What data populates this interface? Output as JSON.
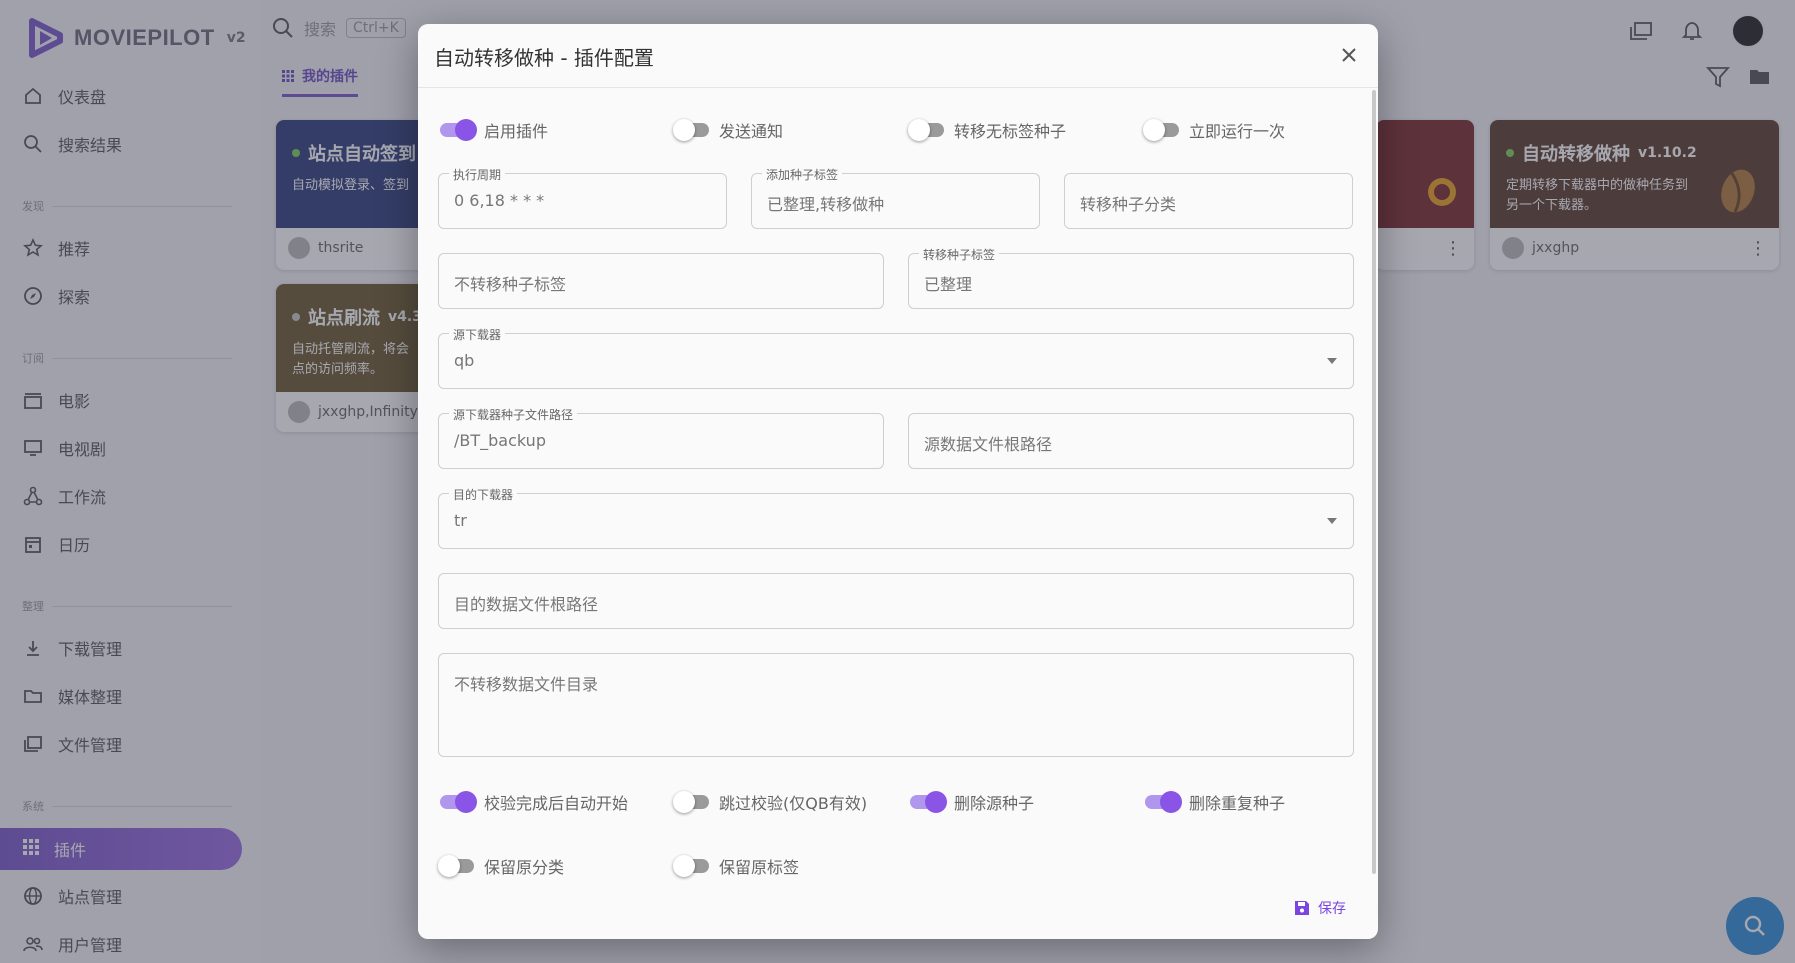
{
  "app": {
    "name": "MOVIEPILOT",
    "version": "v2"
  },
  "search": {
    "placeholder": "搜索",
    "shortcut": "Ctrl+K"
  },
  "sidebar": {
    "items": [
      {
        "label": "仪表盘",
        "icon": "home-icon"
      },
      {
        "label": "搜索结果",
        "icon": "search-icon"
      },
      {
        "label": "推荐",
        "icon": "star-icon"
      },
      {
        "label": "探索",
        "icon": "compass-icon"
      },
      {
        "label": "电影",
        "icon": "clapperboard-icon"
      },
      {
        "label": "电视剧",
        "icon": "monitor-icon"
      },
      {
        "label": "工作流",
        "icon": "workflow-icon"
      },
      {
        "label": "日历",
        "icon": "calendar-icon"
      },
      {
        "label": "下载管理",
        "icon": "download-icon"
      },
      {
        "label": "媒体整理",
        "icon": "folder-arrow-icon"
      },
      {
        "label": "文件管理",
        "icon": "folders-icon"
      },
      {
        "label": "插件",
        "icon": "grid-icon"
      },
      {
        "label": "站点管理",
        "icon": "globe-icon"
      },
      {
        "label": "用户管理",
        "icon": "users-icon"
      }
    ],
    "sections": [
      "发现",
      "订阅",
      "整理",
      "系统"
    ]
  },
  "tabs": {
    "mine": "我的插件"
  },
  "cards": [
    {
      "title": "站点自动签到",
      "desc": "自动模拟登录、签到",
      "author": "thsrite",
      "color": "#2f3f7a"
    },
    {
      "title": "站点刷流",
      "version": "v4.3",
      "desc": "自动托管刷流，将会\n点的访问频率。",
      "author": "jxxghp,InfinityP",
      "color": "#6b5a2e"
    },
    {
      "title": "自动转移做种",
      "version": "v1.10.2",
      "desc": "定期转移下载器中的做种任务到\n另一个下载器。",
      "author": "jxxghp",
      "color": "#5a3d2a"
    }
  ],
  "dialog": {
    "title": "自动转移做种 - 插件配置",
    "switches_top": [
      {
        "label": "启用插件",
        "on": true
      },
      {
        "label": "发送通知",
        "on": false
      },
      {
        "label": "转移无标签种子",
        "on": false
      },
      {
        "label": "立即运行一次",
        "on": false
      }
    ],
    "fields": {
      "cron": {
        "label": "执行周期",
        "value": "0 6,18 * * *"
      },
      "add_tags": {
        "label": "添加种子标签",
        "value": "已整理,转移做种"
      },
      "category": {
        "placeholder": "转移种子分类"
      },
      "exclude_tags": {
        "placeholder": "不转移种子标签"
      },
      "transfer_tags": {
        "label": "转移种子标签",
        "value": "已整理"
      },
      "from_downloader": {
        "label": "源下载器",
        "value": "qb"
      },
      "from_torrent_path": {
        "label": "源下载器种子文件路径",
        "value": "/BT_backup"
      },
      "from_data_path": {
        "placeholder": "源数据文件根路径"
      },
      "to_downloader": {
        "label": "目的下载器",
        "value": "tr"
      },
      "to_data_path": {
        "placeholder": "目的数据文件根路径"
      },
      "exclude_dirs": {
        "placeholder": "不转移数据文件目录"
      }
    },
    "switches_bottom": [
      {
        "label": "校验完成后自动开始",
        "on": true
      },
      {
        "label": "跳过校验(仅QB有效)",
        "on": false
      },
      {
        "label": "删除源种子",
        "on": true
      },
      {
        "label": "删除重复种子",
        "on": true
      }
    ],
    "switches_last": [
      {
        "label": "保留原分类",
        "on": false
      },
      {
        "label": "保留原标签",
        "on": false
      }
    ],
    "save_label": "保存"
  },
  "colors": {
    "accent": "#8a55e6",
    "fab": "#2f8fd6"
  }
}
